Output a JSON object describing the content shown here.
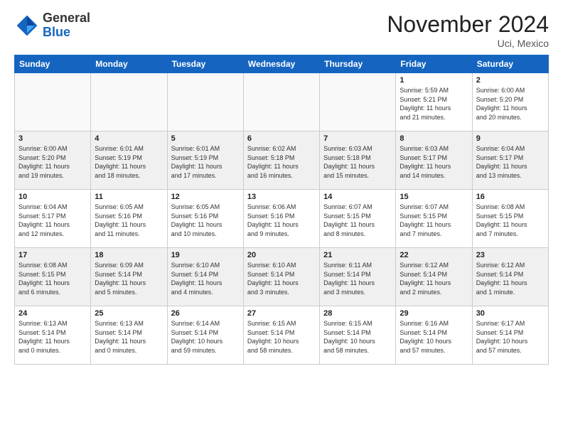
{
  "header": {
    "logo_line1": "General",
    "logo_line2": "Blue",
    "month": "November 2024",
    "location": "Uci, Mexico"
  },
  "weekdays": [
    "Sunday",
    "Monday",
    "Tuesday",
    "Wednesday",
    "Thursday",
    "Friday",
    "Saturday"
  ],
  "weeks": [
    [
      {
        "day": "",
        "info": ""
      },
      {
        "day": "",
        "info": ""
      },
      {
        "day": "",
        "info": ""
      },
      {
        "day": "",
        "info": ""
      },
      {
        "day": "",
        "info": ""
      },
      {
        "day": "1",
        "info": "Sunrise: 5:59 AM\nSunset: 5:21 PM\nDaylight: 11 hours\nand 21 minutes."
      },
      {
        "day": "2",
        "info": "Sunrise: 6:00 AM\nSunset: 5:20 PM\nDaylight: 11 hours\nand 20 minutes."
      }
    ],
    [
      {
        "day": "3",
        "info": "Sunrise: 6:00 AM\nSunset: 5:20 PM\nDaylight: 11 hours\nand 19 minutes."
      },
      {
        "day": "4",
        "info": "Sunrise: 6:01 AM\nSunset: 5:19 PM\nDaylight: 11 hours\nand 18 minutes."
      },
      {
        "day": "5",
        "info": "Sunrise: 6:01 AM\nSunset: 5:19 PM\nDaylight: 11 hours\nand 17 minutes."
      },
      {
        "day": "6",
        "info": "Sunrise: 6:02 AM\nSunset: 5:18 PM\nDaylight: 11 hours\nand 16 minutes."
      },
      {
        "day": "7",
        "info": "Sunrise: 6:03 AM\nSunset: 5:18 PM\nDaylight: 11 hours\nand 15 minutes."
      },
      {
        "day": "8",
        "info": "Sunrise: 6:03 AM\nSunset: 5:17 PM\nDaylight: 11 hours\nand 14 minutes."
      },
      {
        "day": "9",
        "info": "Sunrise: 6:04 AM\nSunset: 5:17 PM\nDaylight: 11 hours\nand 13 minutes."
      }
    ],
    [
      {
        "day": "10",
        "info": "Sunrise: 6:04 AM\nSunset: 5:17 PM\nDaylight: 11 hours\nand 12 minutes."
      },
      {
        "day": "11",
        "info": "Sunrise: 6:05 AM\nSunset: 5:16 PM\nDaylight: 11 hours\nand 11 minutes."
      },
      {
        "day": "12",
        "info": "Sunrise: 6:05 AM\nSunset: 5:16 PM\nDaylight: 11 hours\nand 10 minutes."
      },
      {
        "day": "13",
        "info": "Sunrise: 6:06 AM\nSunset: 5:16 PM\nDaylight: 11 hours\nand 9 minutes."
      },
      {
        "day": "14",
        "info": "Sunrise: 6:07 AM\nSunset: 5:15 PM\nDaylight: 11 hours\nand 8 minutes."
      },
      {
        "day": "15",
        "info": "Sunrise: 6:07 AM\nSunset: 5:15 PM\nDaylight: 11 hours\nand 7 minutes."
      },
      {
        "day": "16",
        "info": "Sunrise: 6:08 AM\nSunset: 5:15 PM\nDaylight: 11 hours\nand 7 minutes."
      }
    ],
    [
      {
        "day": "17",
        "info": "Sunrise: 6:08 AM\nSunset: 5:15 PM\nDaylight: 11 hours\nand 6 minutes."
      },
      {
        "day": "18",
        "info": "Sunrise: 6:09 AM\nSunset: 5:14 PM\nDaylight: 11 hours\nand 5 minutes."
      },
      {
        "day": "19",
        "info": "Sunrise: 6:10 AM\nSunset: 5:14 PM\nDaylight: 11 hours\nand 4 minutes."
      },
      {
        "day": "20",
        "info": "Sunrise: 6:10 AM\nSunset: 5:14 PM\nDaylight: 11 hours\nand 3 minutes."
      },
      {
        "day": "21",
        "info": "Sunrise: 6:11 AM\nSunset: 5:14 PM\nDaylight: 11 hours\nand 3 minutes."
      },
      {
        "day": "22",
        "info": "Sunrise: 6:12 AM\nSunset: 5:14 PM\nDaylight: 11 hours\nand 2 minutes."
      },
      {
        "day": "23",
        "info": "Sunrise: 6:12 AM\nSunset: 5:14 PM\nDaylight: 11 hours\nand 1 minute."
      }
    ],
    [
      {
        "day": "24",
        "info": "Sunrise: 6:13 AM\nSunset: 5:14 PM\nDaylight: 11 hours\nand 0 minutes."
      },
      {
        "day": "25",
        "info": "Sunrise: 6:13 AM\nSunset: 5:14 PM\nDaylight: 11 hours\nand 0 minutes."
      },
      {
        "day": "26",
        "info": "Sunrise: 6:14 AM\nSunset: 5:14 PM\nDaylight: 10 hours\nand 59 minutes."
      },
      {
        "day": "27",
        "info": "Sunrise: 6:15 AM\nSunset: 5:14 PM\nDaylight: 10 hours\nand 58 minutes."
      },
      {
        "day": "28",
        "info": "Sunrise: 6:15 AM\nSunset: 5:14 PM\nDaylight: 10 hours\nand 58 minutes."
      },
      {
        "day": "29",
        "info": "Sunrise: 6:16 AM\nSunset: 5:14 PM\nDaylight: 10 hours\nand 57 minutes."
      },
      {
        "day": "30",
        "info": "Sunrise: 6:17 AM\nSunset: 5:14 PM\nDaylight: 10 hours\nand 57 minutes."
      }
    ]
  ],
  "row_bg": [
    "#ffffff",
    "#f0f0f0",
    "#ffffff",
    "#f0f0f0",
    "#ffffff"
  ]
}
